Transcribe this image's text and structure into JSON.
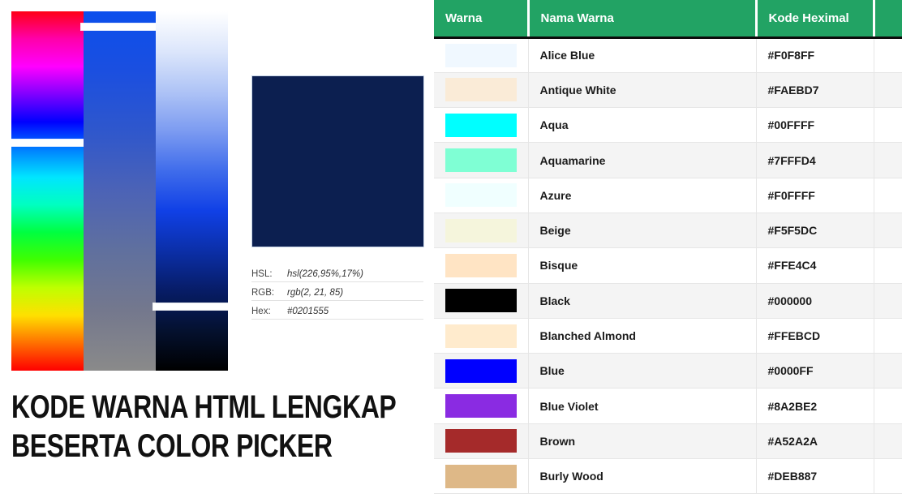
{
  "picker": {
    "strips": [
      {
        "name": "hue-strip",
        "stops": [
          "#FF0015",
          "#FF00AA",
          "#FF00FF",
          "#8000FF",
          "#0000FF",
          "#0080FF",
          "#00E5FF",
          "#00FFC0",
          "#00FF40",
          "#40FF00",
          "#BFFF00",
          "#FFE000",
          "#FF7000",
          "#FF0000"
        ],
        "marker_pct": 36.5
      },
      {
        "name": "saturation-strip",
        "stops": [
          "#0B4FEC",
          "#1B4FE0",
          "#2F57CC",
          "#4C63B6",
          "#60709E",
          "#74788D",
          "#8A8A8A"
        ],
        "marker_pct": 4.3
      },
      {
        "name": "lightness-strip",
        "stops": [
          "#FFFFFF",
          "#DCE6FB",
          "#AFC4F6",
          "#7C9BF1",
          "#3F6CEB",
          "#1040E6",
          "#0B2FA8",
          "#071C66",
          "#04112F",
          "#000000"
        ],
        "marker_pct": 82.2
      }
    ],
    "preview_color": "#0C1F50",
    "values": [
      {
        "label": "HSL:",
        "value": "hsl(226,95%,17%)"
      },
      {
        "label": "RGB:",
        "value": "rgb(2, 21, 85)"
      },
      {
        "label": "Hex:",
        "value": "#0201555"
      }
    ]
  },
  "headline": {
    "line1": "KODE WARNA HTML LENGKAP",
    "line2": "BESERTA COLOR PICKER"
  },
  "table": {
    "accent_color": "#22A364",
    "headers": [
      "Warna",
      "Nama Warna",
      "Kode Heximal",
      ""
    ],
    "rows": [
      {
        "swatch": "#F0F8FF",
        "name": "Alice Blue",
        "hex": "#F0F8FF"
      },
      {
        "swatch": "#FAEBD7",
        "name": "Antique White",
        "hex": "#FAEBD7"
      },
      {
        "swatch": "#00FFFF",
        "name": "Aqua",
        "hex": "#00FFFF"
      },
      {
        "swatch": "#7FFFD4",
        "name": "Aquamarine",
        "hex": "#7FFFD4"
      },
      {
        "swatch": "#F0FFFF",
        "name": "Azure",
        "hex": "#F0FFFF"
      },
      {
        "swatch": "#F5F5DC",
        "name": "Beige",
        "hex": "#F5F5DC"
      },
      {
        "swatch": "#FFE4C4",
        "name": "Bisque",
        "hex": "#FFE4C4"
      },
      {
        "swatch": "#000000",
        "name": "Black",
        "hex": "#000000"
      },
      {
        "swatch": "#FFEBCD",
        "name": "Blanched Almond",
        "hex": "#FFEBCD"
      },
      {
        "swatch": "#0000FF",
        "name": "Blue",
        "hex": "#0000FF"
      },
      {
        "swatch": "#8A2BE2",
        "name": "Blue Violet",
        "hex": "#8A2BE2"
      },
      {
        "swatch": "#A52A2A",
        "name": "Brown",
        "hex": "#A52A2A"
      },
      {
        "swatch": "#DEB887",
        "name": "Burly Wood",
        "hex": "#DEB887"
      }
    ]
  }
}
